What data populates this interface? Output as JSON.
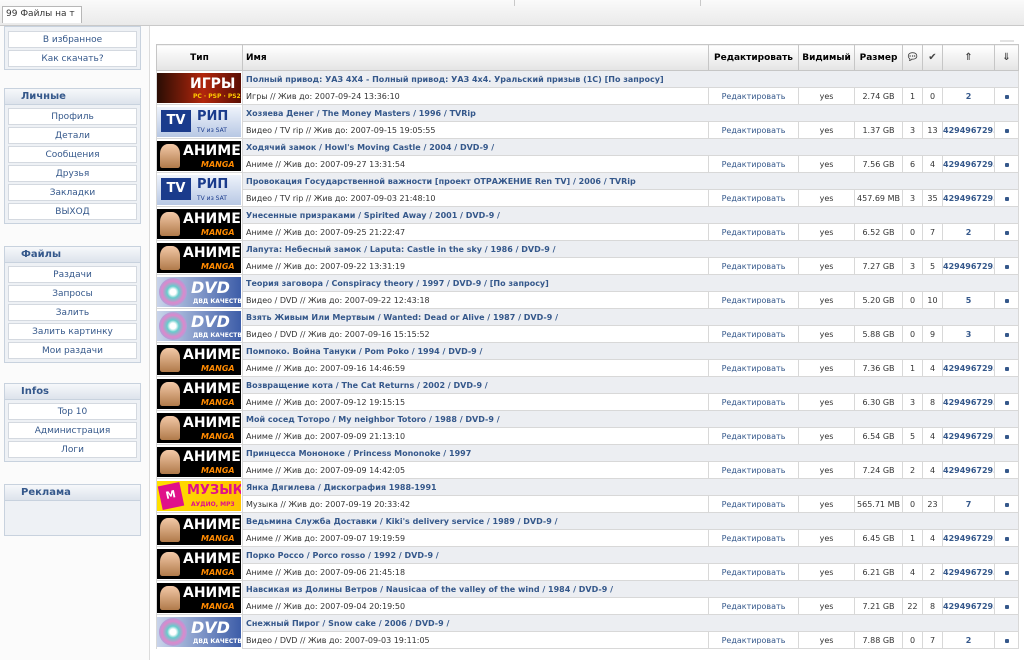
{
  "topbar": {
    "tab_label": "99 Файлы на т"
  },
  "sidebar": {
    "block1": {
      "items": [
        {
          "label": "В избранное"
        },
        {
          "label": "Как скачать?"
        }
      ]
    },
    "personal": {
      "title": "Личные",
      "items": [
        {
          "label": "Профиль"
        },
        {
          "label": "Детали"
        },
        {
          "label": "Сообщения"
        },
        {
          "label": "Друзья"
        },
        {
          "label": "Закладки"
        },
        {
          "label": "ВЫХОД"
        }
      ]
    },
    "files": {
      "title": "Файлы",
      "items": [
        {
          "label": "Раздачи"
        },
        {
          "label": "Запросы"
        },
        {
          "label": "Залить"
        },
        {
          "label": "Залить картинку"
        },
        {
          "label": "Мои раздачи"
        }
      ]
    },
    "infos": {
      "title": "Infos",
      "items": [
        {
          "label": "Top 10"
        },
        {
          "label": "Администрация"
        },
        {
          "label": "Логи"
        }
      ]
    },
    "ads": {
      "title": "Реклама"
    }
  },
  "table": {
    "headers": {
      "type": "Тип",
      "name": "Имя",
      "edit": "Редактировать",
      "visible": "Видимый",
      "size": "Размер"
    },
    "rows": [
      {
        "badge": "igry",
        "badge_text": "ИГРЫ",
        "badge_sub": "PC · PSP · PS2",
        "title": "Полный привод: УАЗ 4Х4 - Полный привод: УАЗ 4х4. Уральский призыв (1С) [По запросу]",
        "info": "Игры // Жив до: 2007-09-24 13:36:10",
        "edit": "Редактировать",
        "visible": "yes",
        "size": "2.74 GB",
        "comments": "1",
        "seeders": "0",
        "leechers": "2"
      },
      {
        "badge": "tv",
        "badge_text": "РИП",
        "badge_sub": "TV из SAT",
        "title": "Хозяева Денег / The Money Masters / 1996 / TVRip",
        "info": "Видео / TV rip // Жив до: 2007-09-15 19:05:55",
        "edit": "Редактировать",
        "visible": "yes",
        "size": "1.37 GB",
        "comments": "3",
        "seeders": "13",
        "leechers": "4294967295"
      },
      {
        "badge": "anime",
        "badge_text": "АНИМЕ",
        "badge_sub": "MANGA",
        "title": "Ходячий замок / Howl's Moving Castle / 2004 / DVD-9 /",
        "info": "Аниме // Жив до: 2007-09-27 13:31:54",
        "edit": "Редактировать",
        "visible": "yes",
        "size": "7.56 GB",
        "comments": "6",
        "seeders": "4",
        "leechers": "4294967295"
      },
      {
        "badge": "tv",
        "badge_text": "РИП",
        "badge_sub": "TV из SAT",
        "title": "Провокация Государственной важности [проект ОТРАЖЕНИЕ Ren TV] / 2006 / TVRip",
        "info": "Видео / TV rip // Жив до: 2007-09-03 21:48:10",
        "edit": "Редактировать",
        "visible": "yes",
        "size": "457.69 MB",
        "comments": "3",
        "seeders": "35",
        "leechers": "4294967295"
      },
      {
        "badge": "anime",
        "badge_text": "АНИМЕ",
        "badge_sub": "MANGA",
        "title": "Унесенные призраками / Spirited Away / 2001 / DVD-9 /",
        "info": "Аниме // Жив до: 2007-09-25 21:22:47",
        "edit": "Редактировать",
        "visible": "yes",
        "size": "6.52 GB",
        "comments": "0",
        "seeders": "7",
        "leechers": "2"
      },
      {
        "badge": "anime",
        "badge_text": "АНИМЕ",
        "badge_sub": "MANGA",
        "title": "Лапута: Небесный замок / Laputa: Castle in the sky / 1986 / DVD-9 /",
        "info": "Аниме // Жив до: 2007-09-22 13:31:19",
        "edit": "Редактировать",
        "visible": "yes",
        "size": "7.27 GB",
        "comments": "3",
        "seeders": "5",
        "leechers": "4294967295"
      },
      {
        "badge": "dvd",
        "badge_text": "DVD",
        "badge_sub": "ДВД КАЧЕСТВО",
        "title": "Теория заговора / Conspiracy theory / 1997 / DVD-9 / [По запросу]",
        "info": "Видео / DVD // Жив до: 2007-09-22 12:43:18",
        "edit": "Редактировать",
        "visible": "yes",
        "size": "5.20 GB",
        "comments": "0",
        "seeders": "10",
        "leechers": "5"
      },
      {
        "badge": "dvd",
        "badge_text": "DVD",
        "badge_sub": "ДВД КАЧЕСТВО",
        "title": "Взять Живым Или Мертвым / Wanted: Dead or Alive / 1987 / DVD-9 /",
        "info": "Видео / DVD // Жив до: 2007-09-16 15:15:52",
        "edit": "Редактировать",
        "visible": "yes",
        "size": "5.88 GB",
        "comments": "0",
        "seeders": "9",
        "leechers": "3"
      },
      {
        "badge": "anime",
        "badge_text": "АНИМЕ",
        "badge_sub": "MANGA",
        "title": "Помпоко. Война Тануки / Pom Poko / 1994 / DVD-9 /",
        "info": "Аниме // Жив до: 2007-09-16 14:46:59",
        "edit": "Редактировать",
        "visible": "yes",
        "size": "7.36 GB",
        "comments": "1",
        "seeders": "4",
        "leechers": "4294967295"
      },
      {
        "badge": "anime",
        "badge_text": "АНИМЕ",
        "badge_sub": "MANGA",
        "title": "Возвращение кота / The Cat Returns / 2002 / DVD-9 /",
        "info": "Аниме // Жив до: 2007-09-12 19:15:15",
        "edit": "Редактировать",
        "visible": "yes",
        "size": "6.30 GB",
        "comments": "3",
        "seeders": "8",
        "leechers": "4294967295"
      },
      {
        "badge": "anime",
        "badge_text": "АНИМЕ",
        "badge_sub": "MANGA",
        "title": "Мой сосед Тоторо / My neighbor Totoro / 1988 / DVD-9 /",
        "info": "Аниме // Жив до: 2007-09-09 21:13:10",
        "edit": "Редактировать",
        "visible": "yes",
        "size": "6.54 GB",
        "comments": "5",
        "seeders": "4",
        "leechers": "4294967295"
      },
      {
        "badge": "anime",
        "badge_text": "АНИМЕ",
        "badge_sub": "MANGA",
        "title": "Принцесса Мононоке / Princess Mononoke / 1997",
        "info": "Аниме // Жив до: 2007-09-09 14:42:05",
        "edit": "Редактировать",
        "visible": "yes",
        "size": "7.24 GB",
        "comments": "2",
        "seeders": "4",
        "leechers": "4294967295"
      },
      {
        "badge": "muz",
        "badge_text": "МУЗЫКА",
        "badge_sub": "АУДИО, MP3",
        "title": "Янка Дягилева / Дискография 1988-1991",
        "info": "Музыка // Жив до: 2007-09-19 20:33:42",
        "edit": "Редактировать",
        "visible": "yes",
        "size": "565.71 MB",
        "comments": "0",
        "seeders": "23",
        "leechers": "7"
      },
      {
        "badge": "anime",
        "badge_text": "АНИМЕ",
        "badge_sub": "MANGA",
        "title": "Ведьмина Служба Доставки / Kiki's delivery service / 1989 / DVD-9 /",
        "info": "Аниме // Жив до: 2007-09-07 19:19:59",
        "edit": "Редактировать",
        "visible": "yes",
        "size": "6.45 GB",
        "comments": "1",
        "seeders": "4",
        "leechers": "4294967295"
      },
      {
        "badge": "anime",
        "badge_text": "АНИМЕ",
        "badge_sub": "MANGA",
        "title": "Порко Россо / Porco rosso / 1992 / DVD-9 /",
        "info": "Аниме // Жив до: 2007-09-06 21:45:18",
        "edit": "Редактировать",
        "visible": "yes",
        "size": "6.21 GB",
        "comments": "4",
        "seeders": "2",
        "leechers": "4294967295"
      },
      {
        "badge": "anime",
        "badge_text": "АНИМЕ",
        "badge_sub": "MANGA",
        "title": "Навсикая из Долины Ветров / Nausicaa of the valley of the wind / 1984 / DVD-9 /",
        "info": "Аниме // Жив до: 2007-09-04 20:19:50",
        "edit": "Редактировать",
        "visible": "yes",
        "size": "7.21 GB",
        "comments": "22",
        "seeders": "8",
        "leechers": "4294967295"
      },
      {
        "badge": "dvd",
        "badge_text": "DVD",
        "badge_sub": "ДВД КАЧЕСТВО",
        "title": "Снежный Пирог / Snow cake / 2006 / DVD-9 /",
        "info": "Видео / DVD // Жив до: 2007-09-03 19:11:05",
        "edit": "Редактировать",
        "visible": "yes",
        "size": "7.88 GB",
        "comments": "0",
        "seeders": "7",
        "leechers": "2"
      }
    ]
  }
}
